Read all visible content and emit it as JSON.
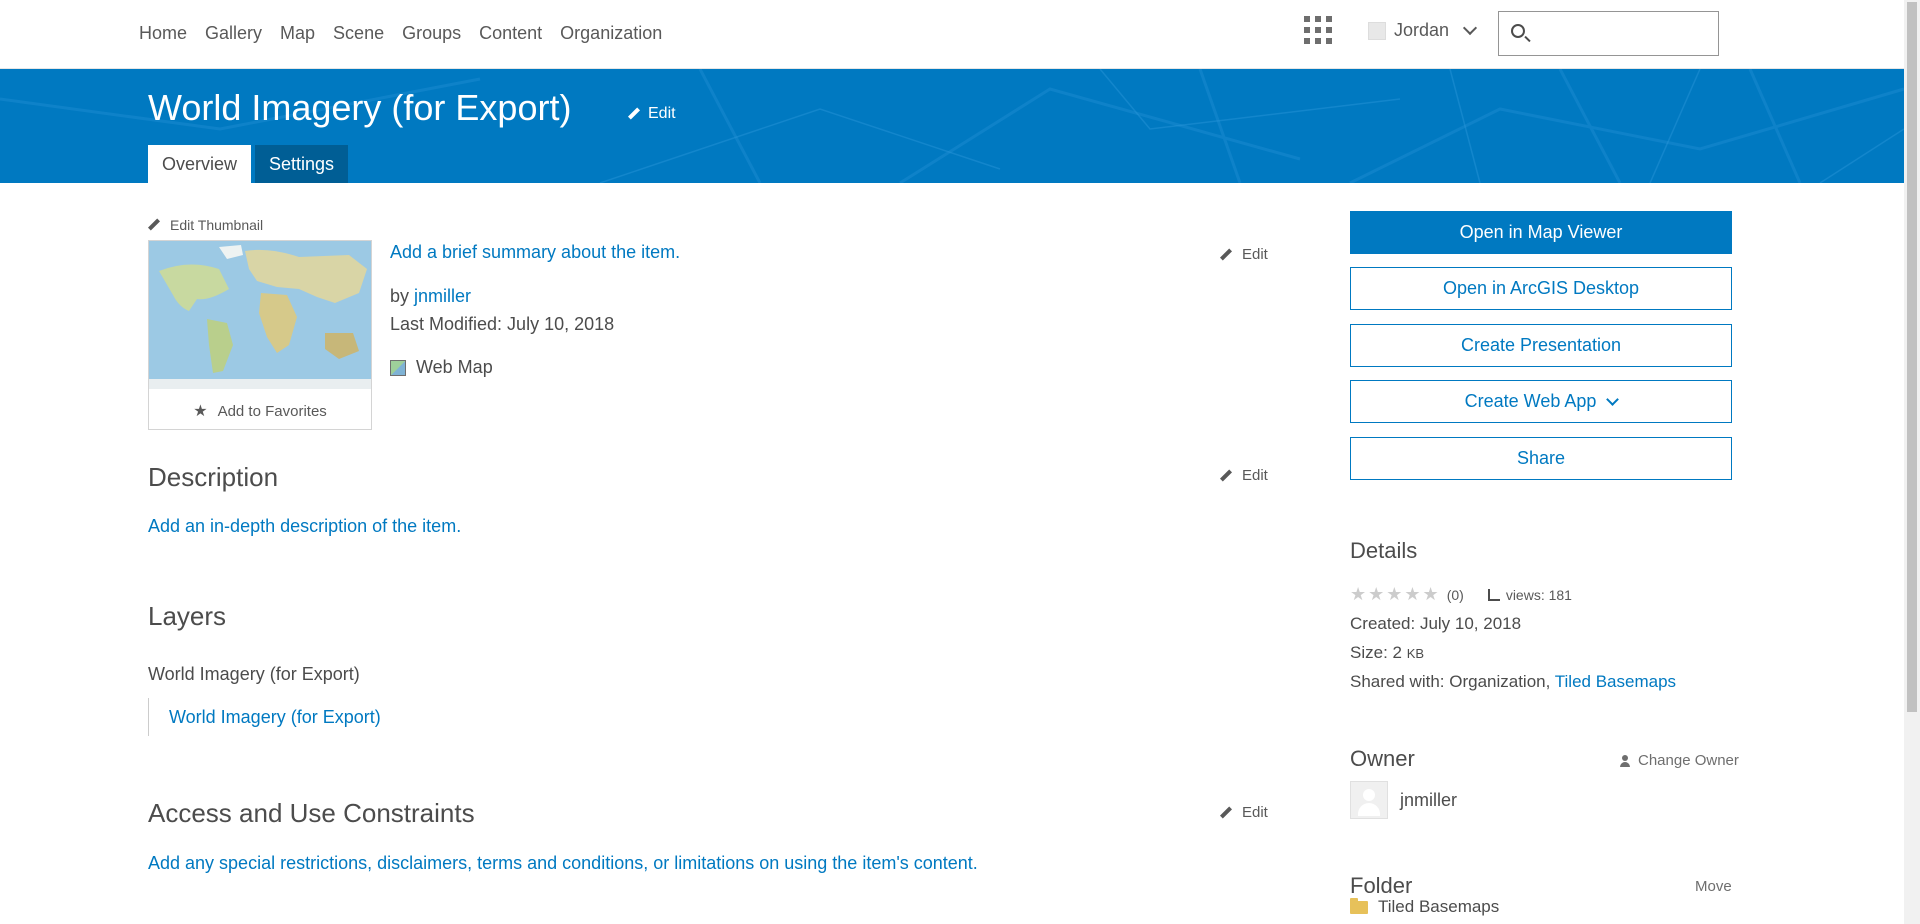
{
  "nav": {
    "links": [
      "Home",
      "Gallery",
      "Map",
      "Scene",
      "Groups",
      "Content",
      "Organization"
    ],
    "user": "Jordan",
    "search_placeholder": ""
  },
  "header": {
    "title": "World Imagery (for Export)",
    "edit_label": "Edit",
    "tabs": [
      {
        "label": "Overview",
        "active": true
      },
      {
        "label": "Settings",
        "active": false
      }
    ]
  },
  "item": {
    "edit_thumbnail": "Edit Thumbnail",
    "add_favorites": "Add to Favorites",
    "summary_prompt": "Add a brief summary about the item.",
    "edit_label": "Edit",
    "by_prefix": "by",
    "owner": "jnmiller",
    "last_modified": "Last Modified: July 10, 2018",
    "type": "Web Map"
  },
  "description": {
    "heading": "Description",
    "edit_label": "Edit",
    "prompt": "Add an in-depth description of the item."
  },
  "layers": {
    "heading": "Layers",
    "parent": "World Imagery (for Export)",
    "child": "World Imagery (for Export)"
  },
  "constraints": {
    "heading": "Access and Use Constraints",
    "edit_label": "Edit",
    "prompt": "Add any special restrictions, disclaimers, terms and conditions, or limitations on using the item's content."
  },
  "actions": {
    "open_map_viewer": "Open in Map Viewer",
    "open_desktop": "Open in ArcGIS Desktop",
    "create_presentation": "Create Presentation",
    "create_web_app": "Create Web App",
    "share": "Share"
  },
  "details": {
    "heading": "Details",
    "rating_stars": "★★★★★",
    "rating_count": "(0)",
    "views": "views: 181",
    "created_label": "Created:",
    "created_value": "July 10, 2018",
    "size_label": "Size:",
    "size_value": "2",
    "size_unit": "KB",
    "shared_label": "Shared with:",
    "shared_org": "Organization,",
    "shared_group": "Tiled Basemaps"
  },
  "owner_panel": {
    "heading": "Owner",
    "change_owner": "Change Owner",
    "name": "jnmiller"
  },
  "folder_panel": {
    "heading": "Folder",
    "move": "Move",
    "name": "Tiled Basemaps"
  },
  "colors": {
    "brand": "#0079c1",
    "tab_inactive": "#005e95"
  }
}
